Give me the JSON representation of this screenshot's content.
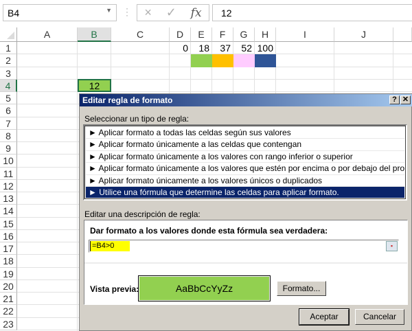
{
  "formula_bar": {
    "name_box": "B4",
    "cancel_icon": "×",
    "enter_icon": "✓",
    "fx_label": "fx",
    "formula_value": "12"
  },
  "sheet": {
    "columns": [
      "A",
      "B",
      "C",
      "D",
      "E",
      "F",
      "G",
      "H",
      "I",
      "J"
    ],
    "rows": [
      "1",
      "2",
      "3",
      "4",
      "5",
      "6",
      "7",
      "8",
      "9",
      "10",
      "11",
      "12",
      "13",
      "14",
      "15",
      "16",
      "17",
      "18",
      "19",
      "20",
      "21",
      "22",
      "23"
    ],
    "row1_values": {
      "D": "0",
      "E": "18",
      "F": "37",
      "G": "52",
      "H": "100"
    },
    "row2_colors": {
      "E": "#92d050",
      "F": "#ffc000",
      "G": "#ffccff",
      "H": "#2f5597"
    },
    "active_cell": {
      "ref": "B4",
      "value": "12",
      "fill": "#92d050"
    }
  },
  "dialog": {
    "title": "Editar regla de formato",
    "help_label": "?",
    "close_label": "✕",
    "select_type_label": "Seleccionar un tipo de regla:",
    "rule_types": [
      "► Aplicar formato a todas las celdas según sus valores",
      "► Aplicar formato únicamente a las celdas que contengan",
      "► Aplicar formato únicamente a los valores con rango inferior o superior",
      "► Aplicar formato únicamente a los valores que estén por encima o por debajo del promedio",
      "► Aplicar formato únicamente a los valores únicos o duplicados",
      "► Utilice una fórmula que determine las celdas para aplicar formato."
    ],
    "selected_rule_index": 5,
    "edit_description_label": "Editar una descripción de regla:",
    "formula_label": "Dar formato a los valores donde esta fórmula sea verdadera:",
    "formula_value": "=B4>0",
    "preview_label": "Vista previa:",
    "preview_text": "AaBbCcYyZz",
    "preview_fill": "#92d050",
    "format_button": "Formato...",
    "ok_button": "Aceptar",
    "cancel_button": "Cancelar"
  }
}
